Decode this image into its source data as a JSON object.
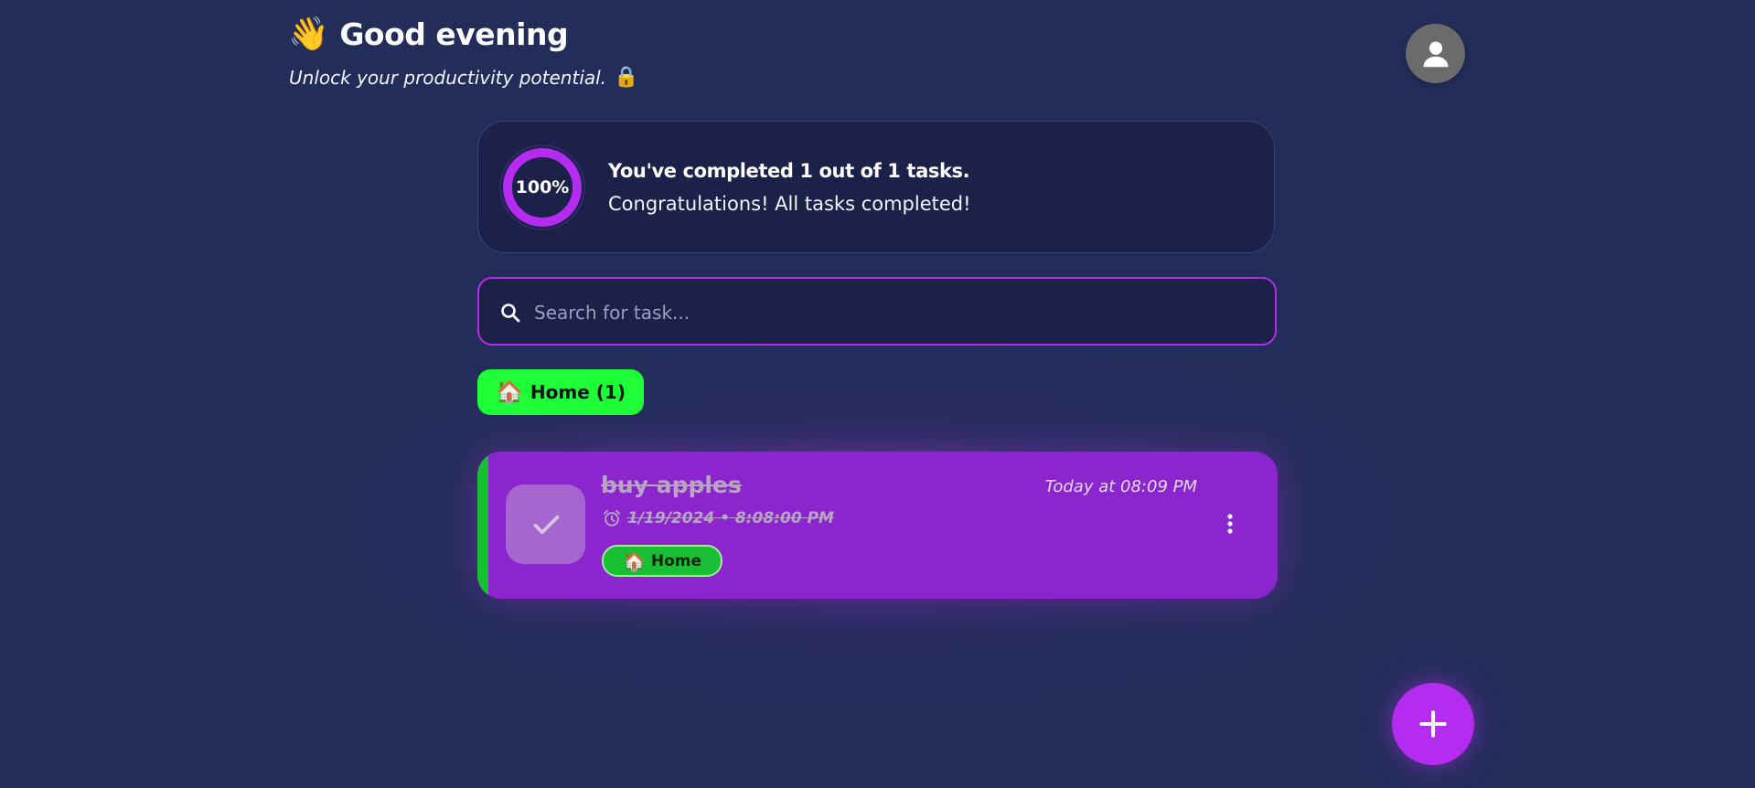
{
  "header": {
    "greeting_emoji": "👋",
    "greeting": "Good evening",
    "subtitle": "Unlock your productivity potential.",
    "subtitle_emoji": "🔒"
  },
  "account": {
    "avatar_icon": "user-icon"
  },
  "progress": {
    "percent_label": "100%",
    "percent": 100,
    "title": "You've completed 1 out of 1 tasks.",
    "message": "Congratulations! All tasks completed!"
  },
  "search": {
    "icon": "search-icon",
    "placeholder": "Search for task..."
  },
  "categories": [
    {
      "emoji": "🏠",
      "label": "Home (1)",
      "color": "#1eff38"
    }
  ],
  "tasks": [
    {
      "name": "buy apples",
      "completed": true,
      "created": "Today at 08:09 PM",
      "deadline": "1/19/2024 • 8:08:00 PM",
      "category": {
        "emoji": "🏠",
        "label": "Home",
        "color": "#18be34"
      },
      "background": "#8b26cf"
    }
  ],
  "fab": {
    "icon": "plus-icon"
  },
  "colors": {
    "background": "#232d5a",
    "card": "#1b2149",
    "accent": "#b52cf1",
    "task": "#8b26cf",
    "category_green": "#1eff38"
  }
}
